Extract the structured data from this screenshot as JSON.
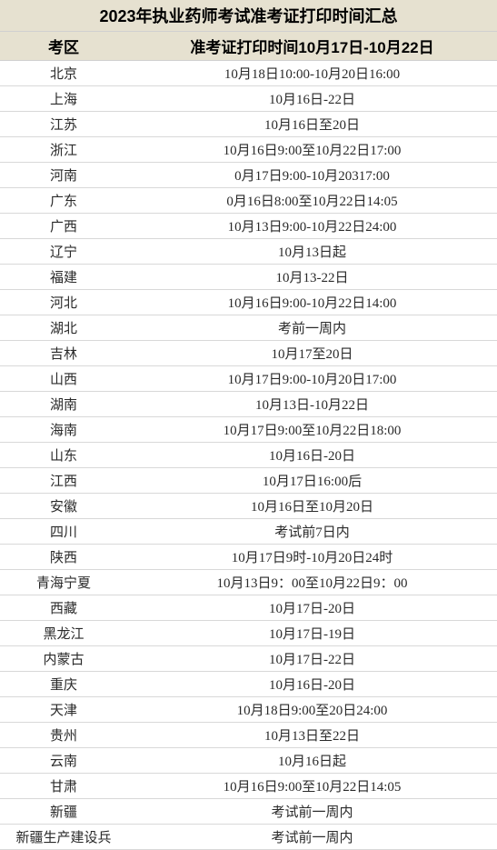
{
  "title": "2023年执业药师考试准考证打印时间汇总",
  "headers": {
    "region": "考区",
    "time": "准考证打印时间10月17日-10月22日"
  },
  "rows": [
    {
      "region": "北京",
      "time": "10月18日10:00-10月20日16:00"
    },
    {
      "region": "上海",
      "time": "10月16日-22日"
    },
    {
      "region": "江苏",
      "time": "10月16日至20日"
    },
    {
      "region": "浙江",
      "time": "10月16日9:00至10月22日17:00"
    },
    {
      "region": "河南",
      "time": "0月17日9:00-10月20317:00"
    },
    {
      "region": "广东",
      "time": "0月16日8:00至10月22日14:05"
    },
    {
      "region": "广西",
      "time": "10月13日9:00-10月22日24:00"
    },
    {
      "region": "辽宁",
      "time": "10月13日起"
    },
    {
      "region": "福建",
      "time": "10月13-22日"
    },
    {
      "region": "河北",
      "time": "10月16日9:00-10月22日14:00"
    },
    {
      "region": "湖北",
      "time": "考前一周内"
    },
    {
      "region": "吉林",
      "time": "10月17至20日"
    },
    {
      "region": "山西",
      "time": "10月17日9:00-10月20日17:00"
    },
    {
      "region": "湖南",
      "time": "10月13日-10月22日"
    },
    {
      "region": "海南",
      "time": "10月17日9:00至10月22日18:00"
    },
    {
      "region": "山东",
      "time": "10月16日-20日"
    },
    {
      "region": "江西",
      "time": "10月17日16:00后"
    },
    {
      "region": "安徽",
      "time": "10月16日至10月20日"
    },
    {
      "region": "四川",
      "time": "考试前7日内"
    },
    {
      "region": "陕西",
      "time": "10月17日9时-10月20日24时"
    },
    {
      "region": "青海宁夏",
      "time": "10月13日9：00至10月22日9：00"
    },
    {
      "region": "西藏",
      "time": "10月17日-20日"
    },
    {
      "region": "黑龙江",
      "time": "10月17日-19日"
    },
    {
      "region": "内蒙古",
      "time": "10月17日-22日"
    },
    {
      "region": "重庆",
      "time": "10月16日-20日"
    },
    {
      "region": "天津",
      "time": "10月18日9:00至20日24:00"
    },
    {
      "region": "贵州",
      "time": "10月13日至22日"
    },
    {
      "region": "云南",
      "time": "10月16日起"
    },
    {
      "region": "甘肃",
      "time": "10月16日9:00至10月22日14:05"
    },
    {
      "region": "新疆",
      "time": "考试前一周内"
    },
    {
      "region": "新疆生产建设兵",
      "time": "考试前一周内"
    }
  ]
}
